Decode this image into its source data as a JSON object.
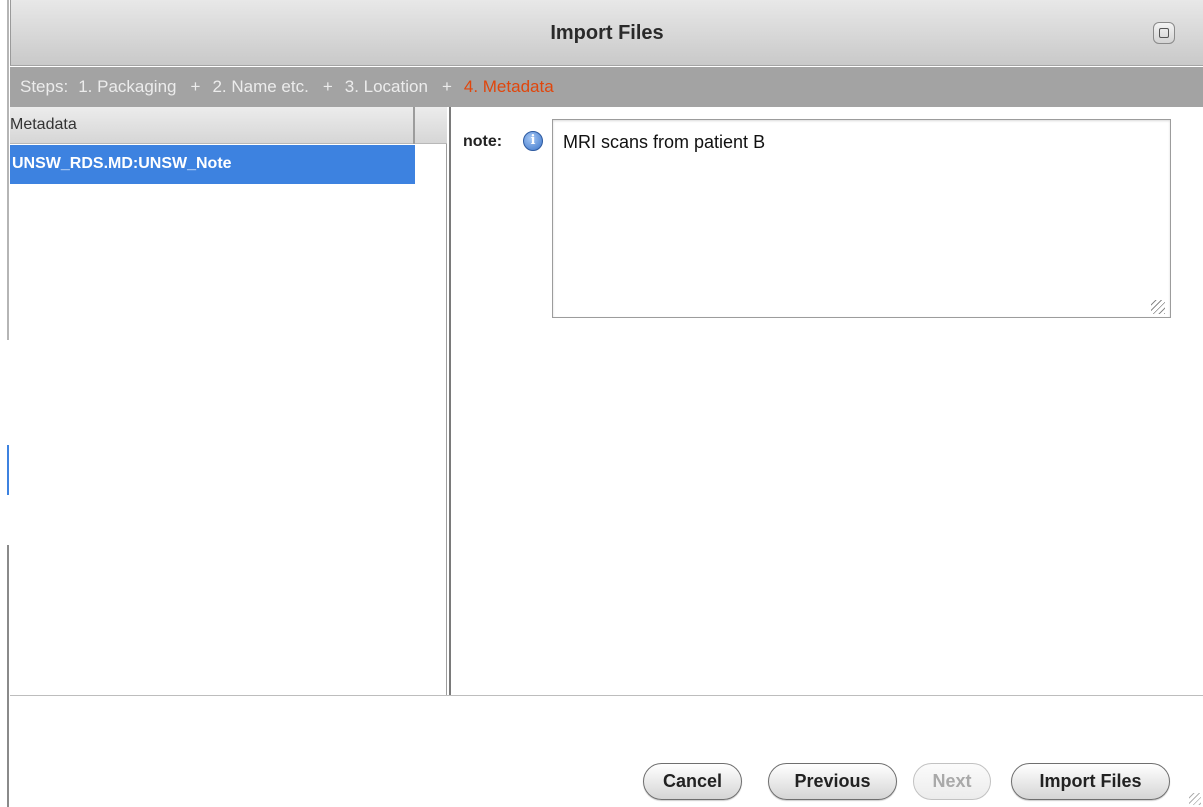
{
  "window": {
    "title": "Import Files"
  },
  "steps": {
    "prefix": "Steps:",
    "items": [
      {
        "label": "1. Packaging",
        "active": false
      },
      {
        "label": "2. Name etc.",
        "active": false
      },
      {
        "label": "3. Location",
        "active": false
      },
      {
        "label": "4. Metadata",
        "active": true
      }
    ],
    "separator": "+"
  },
  "metadata_list": {
    "header": "Metadata",
    "items": [
      {
        "label": "UNSW_RDS.MD:UNSW_Note",
        "selected": true
      }
    ]
  },
  "form": {
    "note_label": "note:",
    "info_icon_glyph": "i",
    "note_value": "MRI scans from patient B"
  },
  "buttons": {
    "cancel": "Cancel",
    "previous": "Previous",
    "next": "Next",
    "import": "Import Files"
  },
  "colors": {
    "active_step": "#e0460c",
    "selection": "#3d82e0",
    "steps_bar": "#a3a3a3"
  },
  "icons": {
    "zoom": "zoom-icon",
    "info": "info-icon",
    "resize": "resize-grip-icon"
  }
}
